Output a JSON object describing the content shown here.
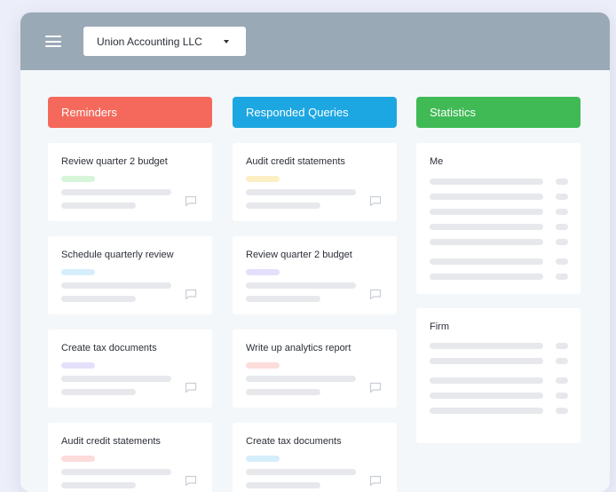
{
  "header": {
    "menu_icon": "hamburger-menu-icon",
    "company": "Union Accounting LLC",
    "dropdown_icon": "caret-down-icon"
  },
  "colors": {
    "reminders": "#f4695b",
    "responded": "#1da7e2",
    "statistics": "#3fba55",
    "topbar": "#9aa9b6"
  },
  "columns": {
    "reminders": {
      "title": "Reminders",
      "cards": [
        {
          "title": "Review quarter 2 budget",
          "tag_color": "#d6f5d9"
        },
        {
          "title": "Schedule quarterly review",
          "tag_color": "#d6eefc"
        },
        {
          "title": "Create tax documents",
          "tag_color": "#e4e0fb"
        },
        {
          "title": "Audit credit statements",
          "tag_color": "#fddcdc"
        }
      ]
    },
    "responded": {
      "title": "Responded Queries",
      "cards": [
        {
          "title": "Audit credit statements",
          "tag_color": "#fdefc4"
        },
        {
          "title": "Review quarter 2 budget",
          "tag_color": "#e4e0fb"
        },
        {
          "title": "Write up analytics report",
          "tag_color": "#fddcdc"
        },
        {
          "title": "Create tax documents",
          "tag_color": "#d6eefc"
        }
      ]
    },
    "statistics": {
      "title": "Statistics",
      "panels": [
        {
          "title": "Me"
        },
        {
          "title": "Firm"
        }
      ]
    }
  },
  "card_icon": "comment-icon"
}
